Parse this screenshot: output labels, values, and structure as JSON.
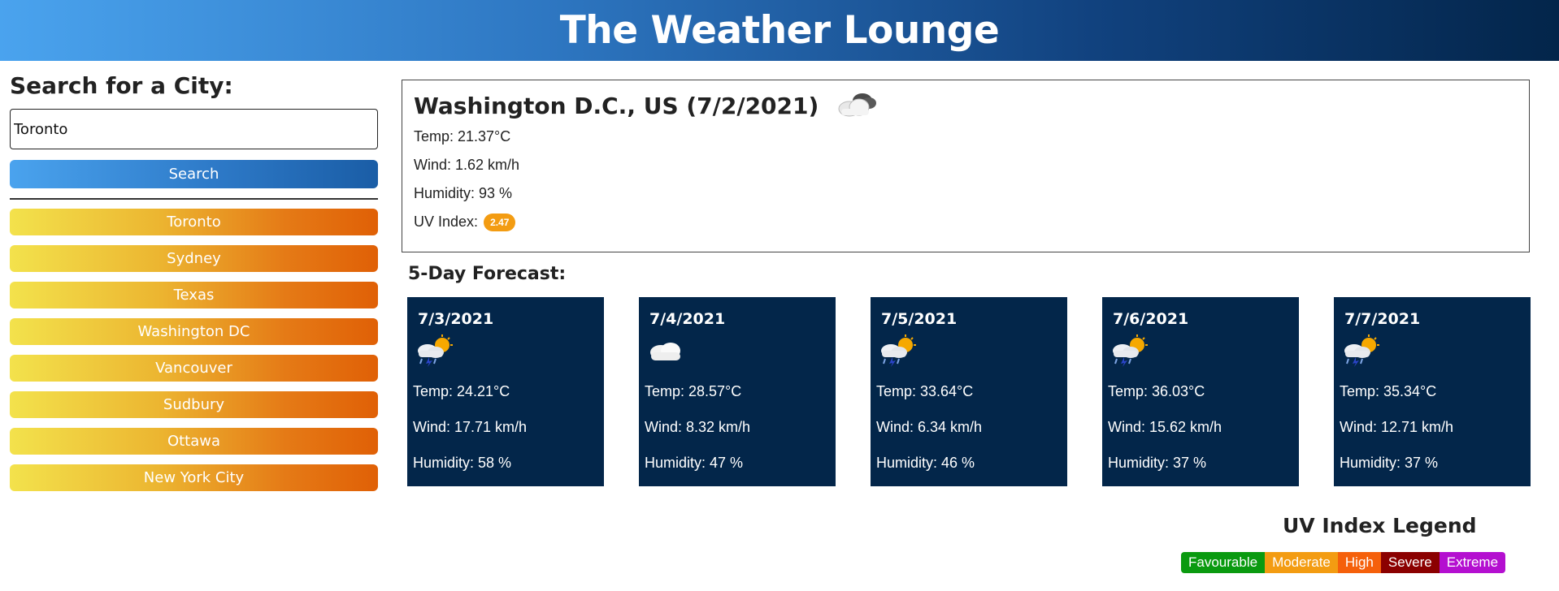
{
  "app": {
    "title": "The Weather Lounge"
  },
  "search": {
    "heading": "Search for a City:",
    "value": "Toronto",
    "button_label": "Search"
  },
  "history": [
    "Toronto",
    "Sydney",
    "Texas",
    "Washington DC",
    "Vancouver",
    "Sudbury",
    "Ottawa",
    "New York City"
  ],
  "current": {
    "title": "Washington D.C., US (7/2/2021)",
    "icon": "cloudy-icon",
    "temp": "Temp: 21.37°C",
    "wind": "Wind: 1.62 km/h",
    "humidity": "Humidity: 93 %",
    "uv_label": "UV Index:",
    "uv_value": "2.47",
    "uv_color": "#f39c12"
  },
  "forecast": {
    "heading": "5-Day Forecast:",
    "days": [
      {
        "date": "7/3/2021",
        "icon": "thunderstorm-sun-icon",
        "temp": "Temp: 24.21°C",
        "wind": "Wind: 17.71 km/h",
        "humidity": "Humidity: 58 %"
      },
      {
        "date": "7/4/2021",
        "icon": "cloud-icon",
        "temp": "Temp: 28.57°C",
        "wind": "Wind: 8.32 km/h",
        "humidity": "Humidity: 47 %"
      },
      {
        "date": "7/5/2021",
        "icon": "thunderstorm-sun-icon",
        "temp": "Temp: 33.64°C",
        "wind": "Wind: 6.34 km/h",
        "humidity": "Humidity: 46 %"
      },
      {
        "date": "7/6/2021",
        "icon": "thunderstorm-sun-icon",
        "temp": "Temp: 36.03°C",
        "wind": "Wind: 15.62 km/h",
        "humidity": "Humidity: 37 %"
      },
      {
        "date": "7/7/2021",
        "icon": "thunderstorm-sun-icon",
        "temp": "Temp: 35.34°C",
        "wind": "Wind: 12.71 km/h",
        "humidity": "Humidity: 37 %"
      }
    ]
  },
  "uv_legend": {
    "heading": "UV Index Legend",
    "items": [
      {
        "label": "Favourable",
        "color": "#0a9a10"
      },
      {
        "label": "Moderate",
        "color": "#f39c12"
      },
      {
        "label": "High",
        "color": "#f5600b"
      },
      {
        "label": "Severe",
        "color": "#8b0000"
      },
      {
        "label": "Extreme",
        "color": "#b40fd0"
      }
    ]
  }
}
